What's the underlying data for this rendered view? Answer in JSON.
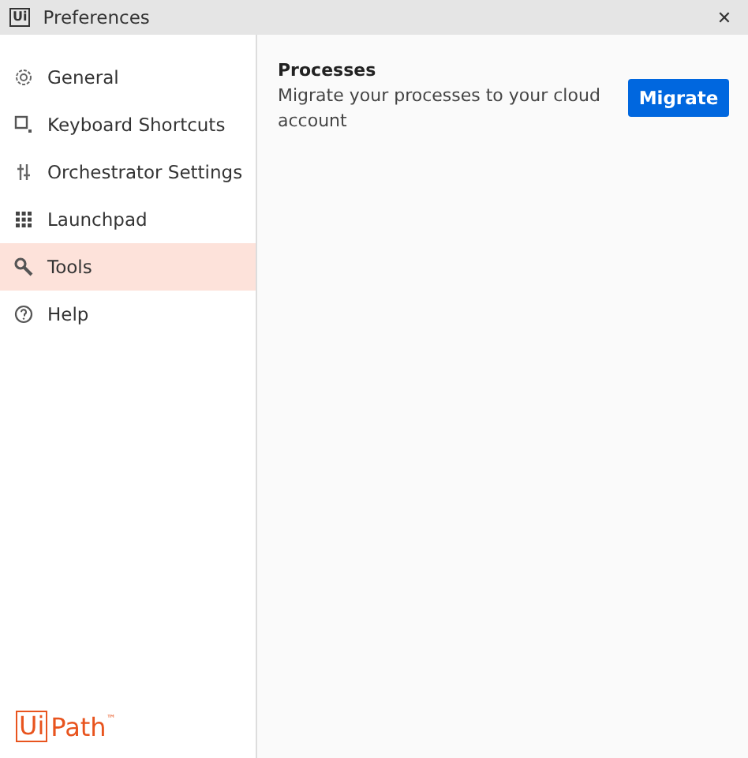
{
  "window": {
    "app_icon": "Ui",
    "title": "Preferences",
    "close": "✕"
  },
  "sidebar": {
    "items": [
      {
        "label": "General",
        "selected": false
      },
      {
        "label": "Keyboard Shortcuts",
        "selected": false
      },
      {
        "label": "Orchestrator Settings",
        "selected": false
      },
      {
        "label": "Launchpad",
        "selected": false
      },
      {
        "label": "Tools",
        "selected": true
      },
      {
        "label": "Help",
        "selected": false
      }
    ],
    "logo": {
      "boxed": "Ui",
      "rest": "Path",
      "mark": "™"
    }
  },
  "content": {
    "section_title": "Processes",
    "description": "Migrate your processes to your cloud account",
    "button": "Migrate"
  }
}
